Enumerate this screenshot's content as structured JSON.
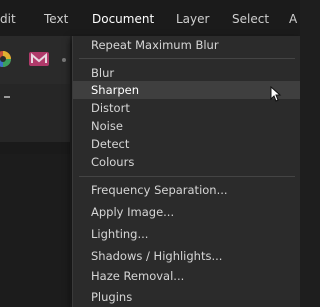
{
  "menubar": {
    "items": [
      {
        "label": "dit"
      },
      {
        "label": "Text"
      },
      {
        "label": "Document"
      },
      {
        "label": "Layer"
      },
      {
        "label": "Select"
      },
      {
        "label": "A"
      }
    ]
  },
  "toolbar": {
    "icons": [
      "color-wheel-icon",
      "mask-icon"
    ]
  },
  "document_menu": {
    "repeat_label": "Repeat Maximum Blur",
    "filter_groups": [
      "Blur",
      "Sharpen",
      "Distort",
      "Noise",
      "Detect",
      "Colours"
    ],
    "commands": [
      "Frequency Separation...",
      "Apply Image...",
      "Lighting...",
      "Shadows / Highlights...",
      "Haze Removal...",
      "Plugins"
    ],
    "highlighted": "Sharpen"
  }
}
